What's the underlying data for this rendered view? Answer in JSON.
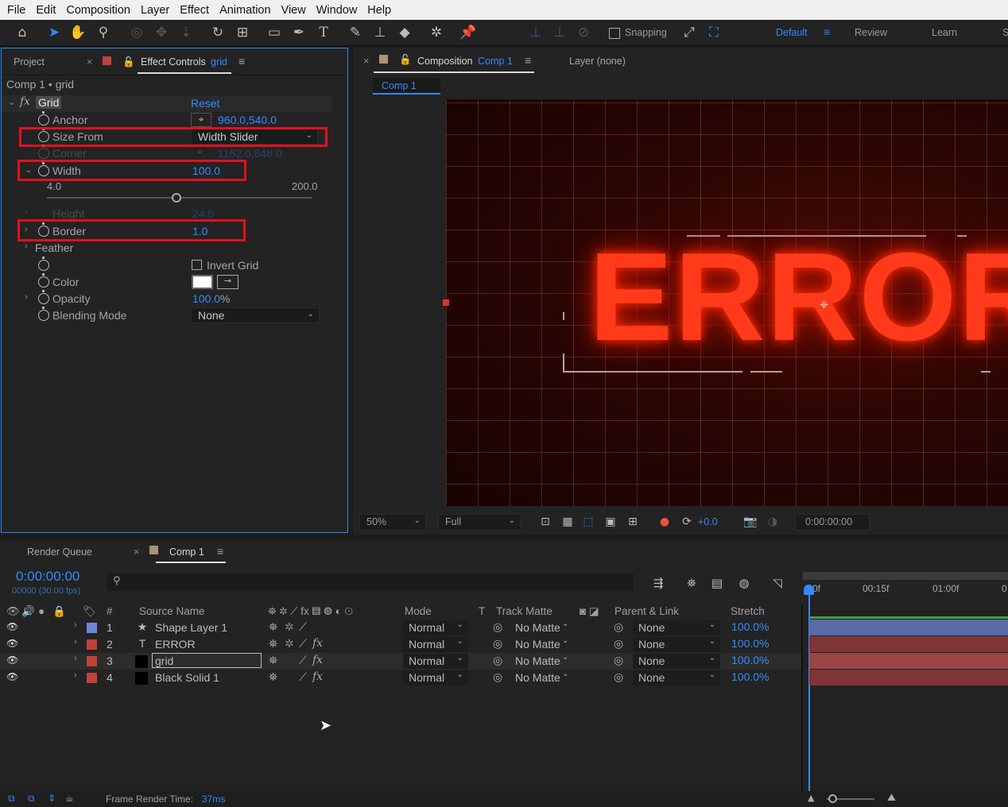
{
  "menu": [
    "File",
    "Edit",
    "Composition",
    "Layer",
    "Effect",
    "Animation",
    "View",
    "Window",
    "Help"
  ],
  "toolbar": {
    "snapping_label": "Snapping",
    "workspaces": [
      "Default",
      "Review",
      "Learn",
      "S"
    ]
  },
  "left_panel": {
    "tab_project": "Project",
    "tab_effect_controls": "Effect Controls",
    "tab_effect_controls_target": "grid",
    "breadcrumb": "Comp 1 • grid",
    "effect_name": "Grid",
    "fx_label": "fx",
    "reset_label": "Reset",
    "properties": {
      "anchor": {
        "label": "Anchor",
        "value": "960.0,540.0"
      },
      "size_from": {
        "label": "Size From",
        "value": "Width Slider"
      },
      "corner": {
        "label": "Corner",
        "value": "1152.0,648.0"
      },
      "width": {
        "label": "Width",
        "value": "100.0",
        "slider_min": "4.0",
        "slider_max": "200.0",
        "slider_fraction": 0.49
      },
      "height": {
        "label": "Height",
        "value": "24.0"
      },
      "border": {
        "label": "Border",
        "value": "1.0"
      },
      "feather": {
        "label": "Feather"
      },
      "invert_grid": {
        "label": "Invert Grid"
      },
      "color": {
        "label": "Color"
      },
      "opacity": {
        "label": "Opacity",
        "value": "100.0",
        "unit": "%"
      },
      "blending_mode": {
        "label": "Blending Mode",
        "value": "None"
      }
    }
  },
  "comp_panel": {
    "tab_composition": "Composition",
    "tab_composition_target": "Comp 1",
    "tab_layer": "Layer (none)",
    "subtab": "Comp 1",
    "viewer_text": "ERROR",
    "zoom": "50%",
    "resolution": "Full",
    "exposure": "+0.0",
    "timecode": "0:00:00:00"
  },
  "timeline": {
    "tab_render_queue": "Render Queue",
    "tab_comp": "Comp 1",
    "timecode": "0:00:00:00",
    "frames_fps": "00000 (30.00 fps)",
    "ruler_labels": [
      "0f",
      "00:15f",
      "01:00f",
      "0"
    ],
    "headers": {
      "num": "#",
      "source_name": "Source Name",
      "mode": "Mode",
      "t": "T",
      "track_matte": "Track Matte",
      "parent_link": "Parent & Link",
      "stretch": "Stretch"
    },
    "layers": [
      {
        "num": "1",
        "name": "Shape Layer 1",
        "type_icon": "star-icon",
        "color": "#6e87d6",
        "mode": "Normal",
        "matte": "No Matte",
        "parent": "None",
        "stretch": "100.0%"
      },
      {
        "num": "2",
        "name": "ERROR",
        "type_icon": "text-icon",
        "color": "#c0413a",
        "mode": "Normal",
        "matte": "No Matte",
        "parent": "None",
        "stretch": "100.0%"
      },
      {
        "num": "3",
        "name": "grid",
        "type_icon": "solid-icon",
        "color": "#c0413a",
        "mode": "Normal",
        "matte": "No Matte",
        "parent": "None",
        "stretch": "100.0%"
      },
      {
        "num": "4",
        "name": "Black Solid 1",
        "type_icon": "solid-icon",
        "color": "#c0413a",
        "mode": "Normal",
        "matte": "No Matte",
        "parent": "None",
        "stretch": "100.0%"
      }
    ],
    "status_text": "Frame Render Time:",
    "status_value": "37ms"
  },
  "colors": {
    "accent": "#2f8bff",
    "highlight_box": "#e0101f",
    "error_glow": "#ff3a1a"
  }
}
